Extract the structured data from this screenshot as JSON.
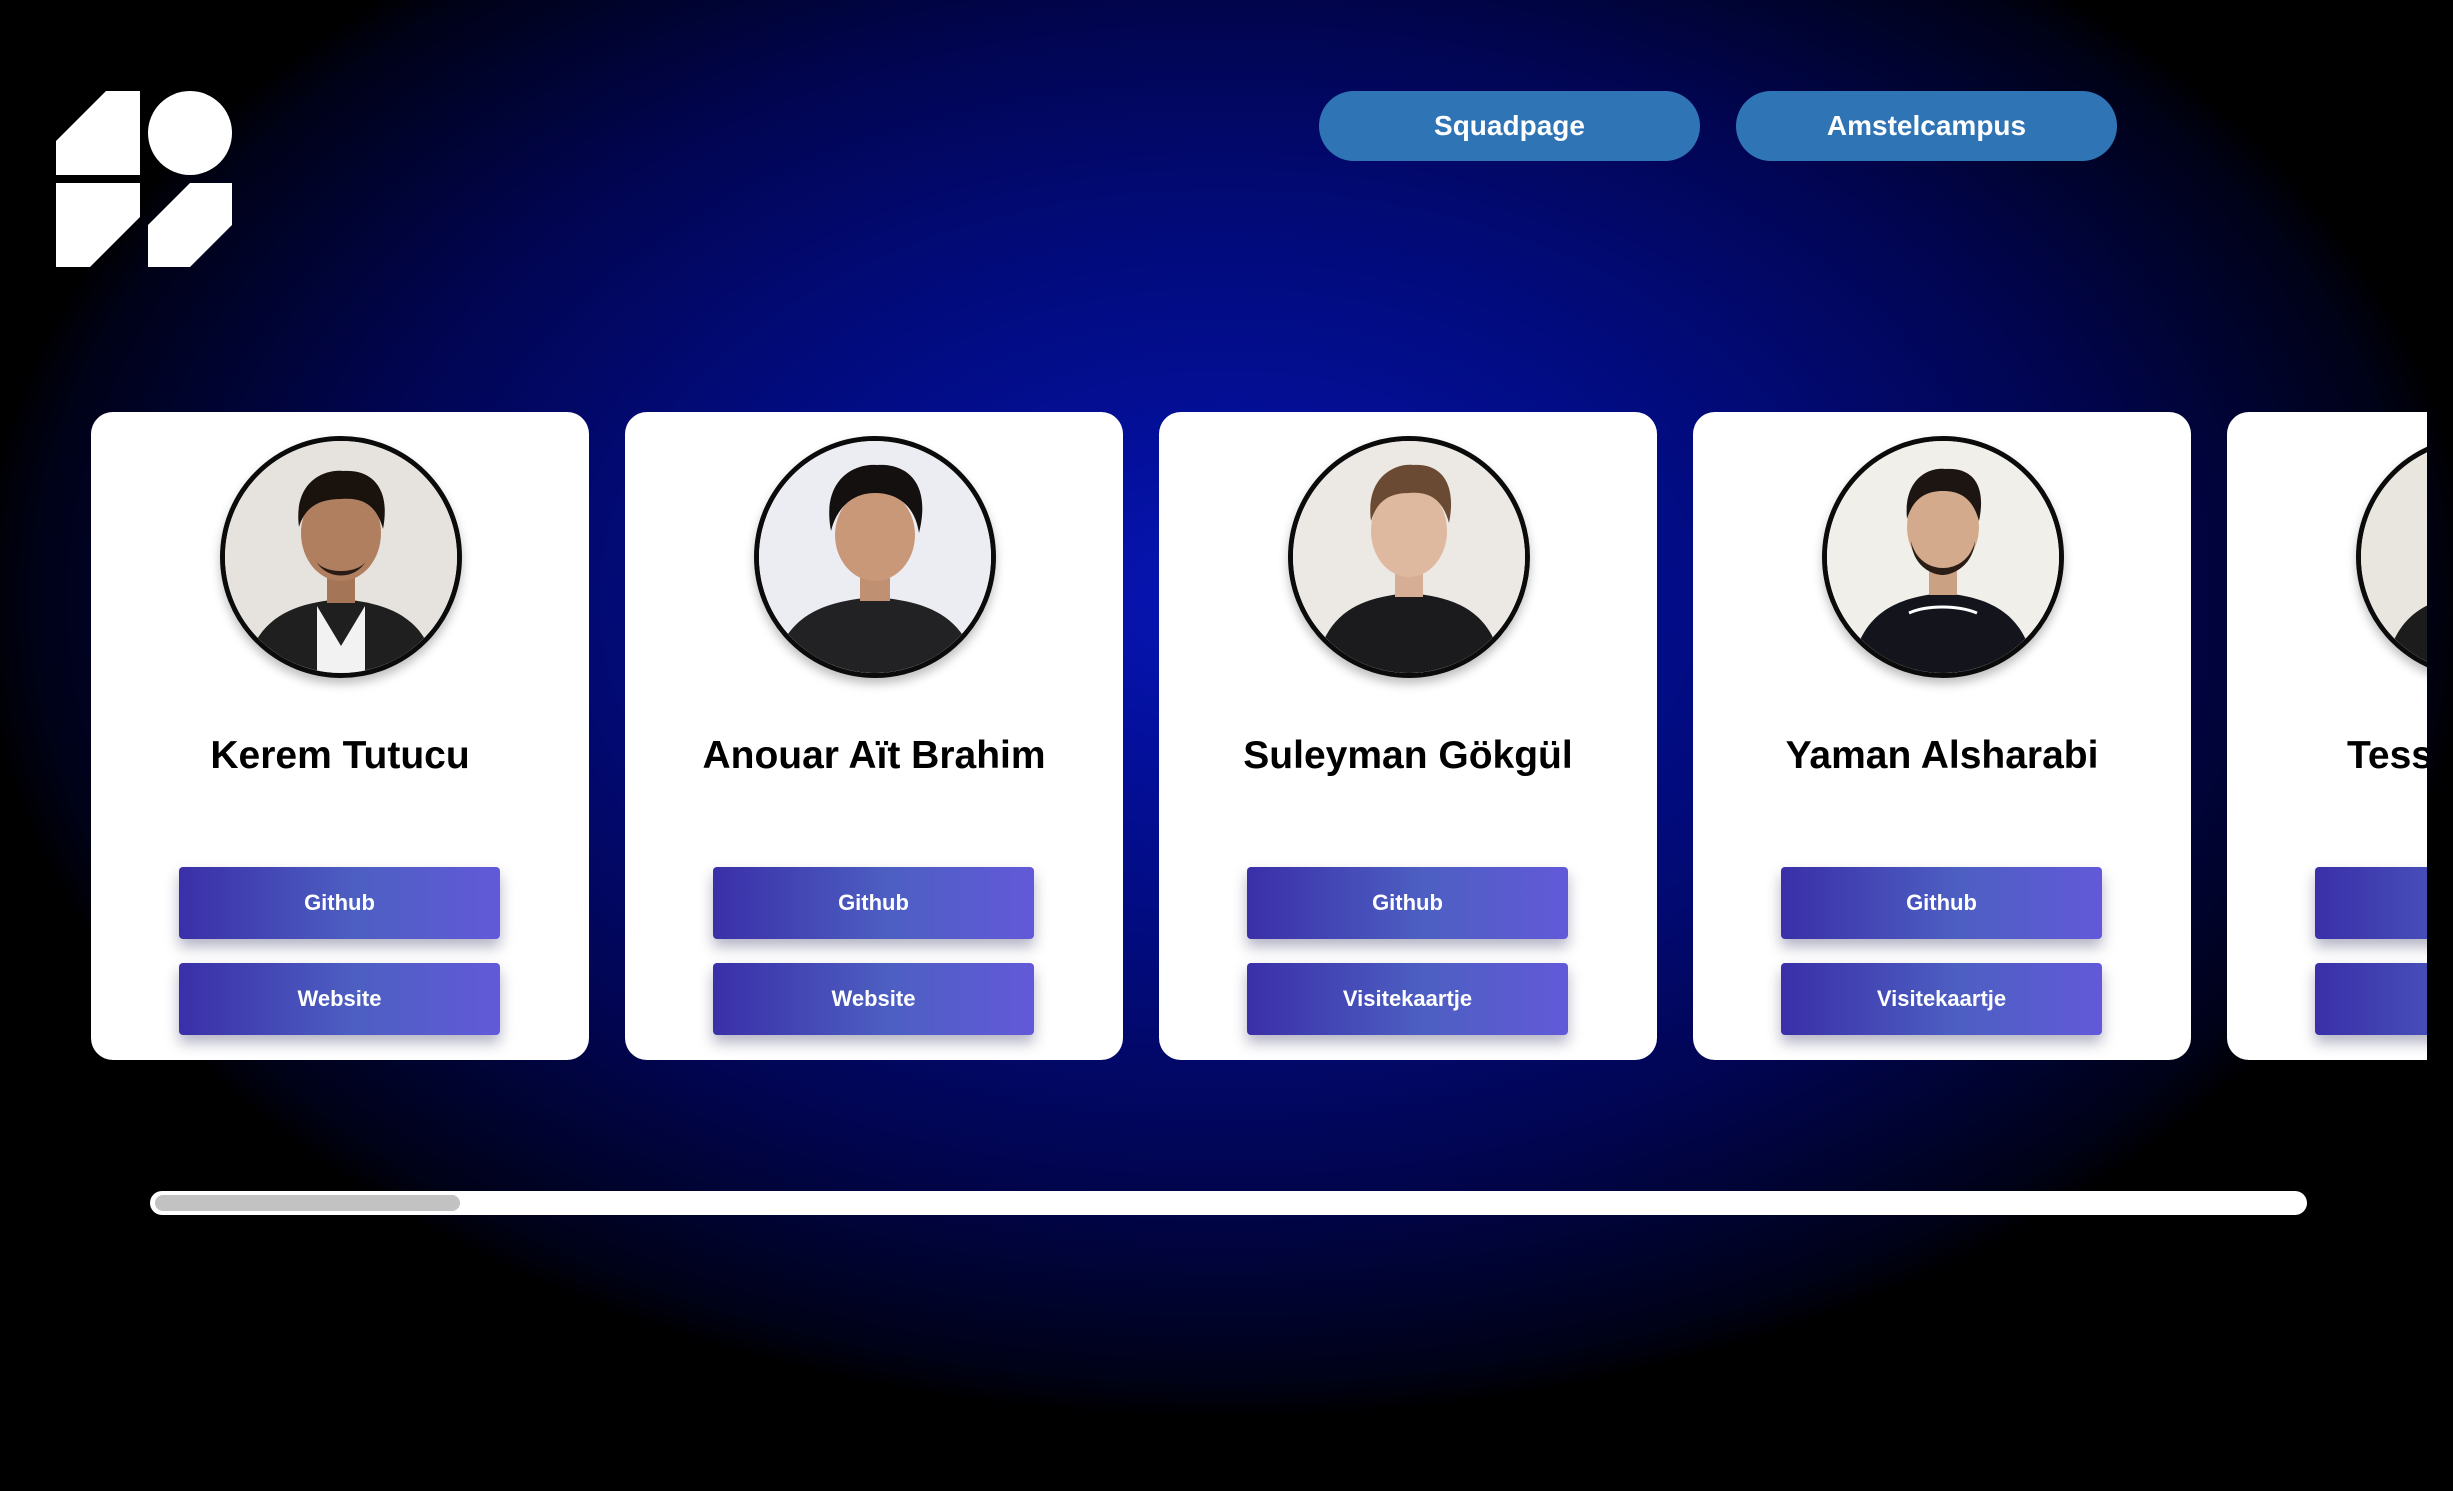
{
  "nav": {
    "squadpage_label": "Squadpage",
    "amstelcampus_label": "Amstelcampus"
  },
  "logo": {
    "icon": "fdnd-logo-icon"
  },
  "cards": [
    {
      "name": "Kerem Tutucu",
      "button_1": "Github",
      "button_2": "Website"
    },
    {
      "name": "Anouar Aït Brahim",
      "button_1": "Github",
      "button_2": "Website"
    },
    {
      "name": "Suleyman Gökgül",
      "button_1": "Github",
      "button_2": "Visitekaartje"
    },
    {
      "name": "Yaman Alsharabi",
      "button_1": "Github",
      "button_2": "Visitekaartje"
    },
    {
      "name": "Tess",
      "button_1": "",
      "button_2": ""
    }
  ],
  "scrollbar": {
    "position_fraction": 0.0,
    "visible_fraction": 0.14
  },
  "colors": {
    "nav_button": "#2f75b5",
    "card_button_start": "#3a2fa8",
    "card_button_end": "#6259d8",
    "background_center": "#0716b6",
    "background_edge": "#000000"
  }
}
